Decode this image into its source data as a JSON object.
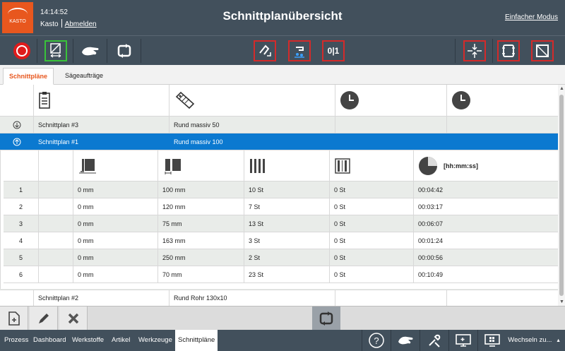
{
  "header": {
    "logo_text": "KASTO",
    "time": "14:14:52",
    "user": "Kasto",
    "logout_label": "Abmelden",
    "title": "Schnittplanübersicht",
    "simple_mode_label": "Einfacher Modus"
  },
  "toolbar": {
    "buttons_left": [
      "stop-icon",
      "saw-feed-icon",
      "hand-icon",
      "cycle-icon"
    ],
    "buttons_center": [
      "bend-icon",
      "coolant-icon",
      "toggle-01-icon"
    ],
    "center_toggle_text": "0|1",
    "buttons_right": [
      "clamp-center-icon",
      "frame-icon",
      "cut-square-icon"
    ]
  },
  "tabs": [
    {
      "label": "Schnittpläne",
      "active": true
    },
    {
      "label": "Sägeaufträge",
      "active": false
    }
  ],
  "plans": [
    {
      "name": "Schnittplan #3",
      "material": "Rund massiv 50",
      "expanded": false,
      "selected": false
    },
    {
      "name": "Schnittplan #1",
      "material": "Rund massiv 100",
      "expanded": true,
      "selected": true
    },
    {
      "name": "Schnittplan #2",
      "material": "Rund Rohr 130x10",
      "expanded": false,
      "selected": false
    }
  ],
  "detail": {
    "time_format_label": "[hh:mm:ss]",
    "rows": [
      {
        "index": "1",
        "trim": "0 mm",
        "length": "100 mm",
        "count": "10 St",
        "done": "0 St",
        "time": "00:04:42"
      },
      {
        "index": "2",
        "trim": "0 mm",
        "length": "120 mm",
        "count": "7 St",
        "done": "0 St",
        "time": "00:03:17"
      },
      {
        "index": "3",
        "trim": "0 mm",
        "length": "75 mm",
        "count": "13 St",
        "done": "0 St",
        "time": "00:06:07"
      },
      {
        "index": "4",
        "trim": "0 mm",
        "length": "163 mm",
        "count": "3 St",
        "done": "0 St",
        "time": "00:01:24"
      },
      {
        "index": "5",
        "trim": "0 mm",
        "length": "250 mm",
        "count": "2 St",
        "done": "0 St",
        "time": "00:00:56"
      },
      {
        "index": "6",
        "trim": "0 mm",
        "length": "70 mm",
        "count": "23 St",
        "done": "0 St",
        "time": "00:10:49"
      }
    ]
  },
  "footer": {
    "tabs": [
      "Prozess",
      "Dashboard",
      "Werkstoffe",
      "Artikel",
      "Werkzeuge",
      "Schnittpläne"
    ],
    "active_tab": "Schnittpläne",
    "switch_label": "Wechseln zu..."
  },
  "colors": {
    "header_bg": "#42505c",
    "accent_orange": "#e8571e",
    "selected_blue": "#0b79d0",
    "highlight_red": "#d42a2a",
    "highlight_green": "#39c33a"
  }
}
